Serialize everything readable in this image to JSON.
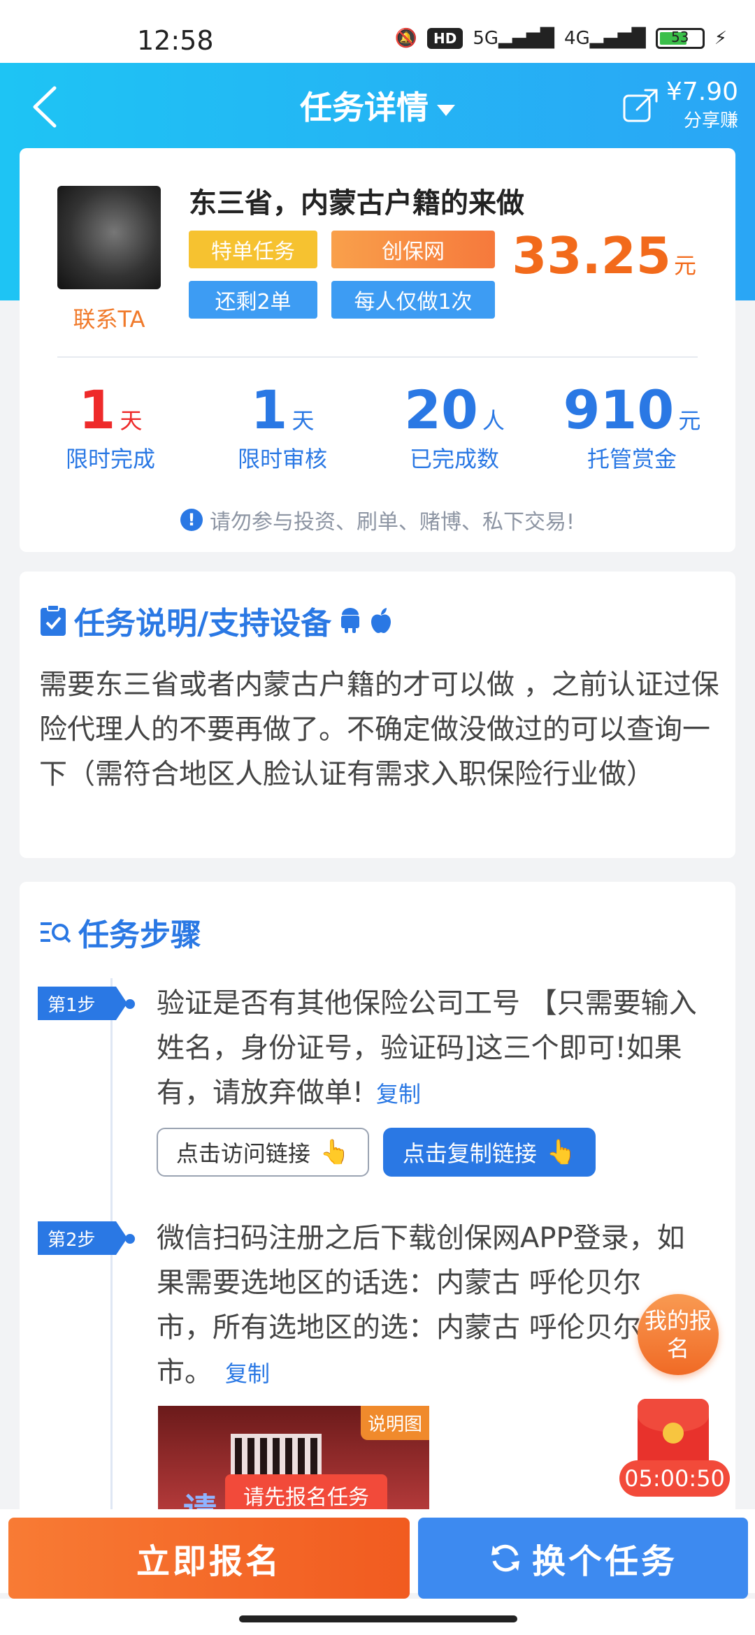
{
  "status_bar": {
    "time": "12:58",
    "hd": "HD",
    "net1": "5G",
    "net2": "4G",
    "battery": "53"
  },
  "header": {
    "title": "任务详情",
    "share_amount": "¥7.90",
    "share_label": "分享赚"
  },
  "task": {
    "title": "东三省，内蒙古户籍的来做",
    "contact": "联系TA",
    "tags": [
      "特单任务",
      "创保网",
      "还剩2单",
      "每人仅做1次"
    ],
    "price": "33.25",
    "price_unit": "元",
    "stats": [
      {
        "value": "1",
        "unit": "天",
        "label": "限时完成"
      },
      {
        "value": "1",
        "unit": "天",
        "label": "限时审核"
      },
      {
        "value": "20",
        "unit": "人",
        "label": "已完成数"
      },
      {
        "value": "910",
        "unit": "元",
        "label": "托管赏金"
      }
    ],
    "warning": "请勿参与投资、刷单、赌博、私下交易!",
    "colors": {
      "accent": "#2a78e4",
      "price": "#f26a1b",
      "red": "#ee2a2a"
    }
  },
  "description": {
    "title": "任务说明/支持设备",
    "text": "需要东三省或者内蒙古户籍的才可以做 ，之前认证过保险代理人的不要再做了。不确定做没做过的可以查询一下（需符合地区人脸认证有需求入职保险行业做）"
  },
  "steps": {
    "title": "任务步骤",
    "items": [
      {
        "tag": "第1步",
        "text": "验证是否有其他保险公司工号 【只需要输入姓名，身份证号，验证码]这三个即可!如果有，请放弃做单!",
        "copy": "复制"
      },
      {
        "tag": "第2步",
        "text": "微信扫码注册之后下载创保网APP登录，如果需要选地区的话选：内蒙古 呼伦贝尔市，所有选地区的选：内蒙古 呼伦贝尔市。",
        "copy": "复制"
      }
    ],
    "visit_link": "点击访问链接",
    "copy_link": "点击复制链接",
    "image_badge": "说明图",
    "image_text": "请",
    "tooltip": "请先报名任务"
  },
  "floating": {
    "signup": "我的报名",
    "timer": "05:00:50"
  },
  "bottom": {
    "signup": "立即报名",
    "change": "换个任务"
  }
}
